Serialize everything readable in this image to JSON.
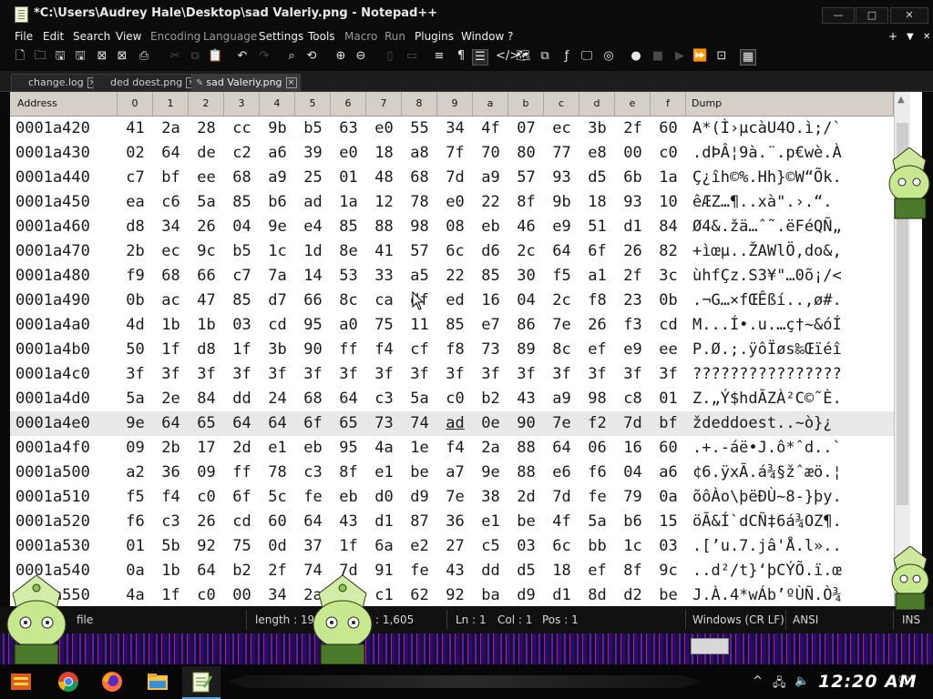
{
  "window": {
    "title": "*C:\\Users\\Audrey Hale\\Desktop\\sad Valeriy.png - Notepad++",
    "btn_min": "—",
    "btn_max": "□",
    "btn_close": "✕"
  },
  "menu": {
    "items": [
      "File",
      "Edit",
      "Search",
      "View",
      "Encoding",
      "Language",
      "Settings",
      "Tools",
      "Macro",
      "Run",
      "Plugins",
      "Window",
      "?"
    ],
    "right_plus": "+",
    "right_arrow": "▼",
    "right_close": "✕"
  },
  "tabs": [
    {
      "label": "change.log"
    },
    {
      "label": "ded doest.png"
    },
    {
      "label": "sad Valeriy.png"
    }
  ],
  "hex_header": {
    "address": "Address",
    "columns": [
      "0",
      "1",
      "2",
      "3",
      "4",
      "5",
      "6",
      "7",
      "8",
      "9",
      "a",
      "b",
      "c",
      "d",
      "e",
      "f"
    ],
    "dump": "Dump"
  },
  "hex_rows": [
    {
      "addr": "0001a420",
      "bytes": [
        "41",
        "2a",
        "28",
        "cc",
        "9b",
        "b5",
        "63",
        "e0",
        "55",
        "34",
        "4f",
        "07",
        "ec",
        "3b",
        "2f",
        "60"
      ],
      "dump": "A*(Ì›µcàU4O.ì;/`"
    },
    {
      "addr": "0001a430",
      "bytes": [
        "02",
        "64",
        "de",
        "c2",
        "a6",
        "39",
        "e0",
        "18",
        "a8",
        "7f",
        "70",
        "80",
        "77",
        "e8",
        "00",
        "c0"
      ],
      "dump": ".dÞÂ¦9à.¨.p€wè.À"
    },
    {
      "addr": "0001a440",
      "bytes": [
        "c7",
        "bf",
        "ee",
        "68",
        "a9",
        "25",
        "01",
        "48",
        "68",
        "7d",
        "a9",
        "57",
        "93",
        "d5",
        "6b",
        "1a"
      ],
      "dump": "Ç¿îh©%.Hh}©W“Õk."
    },
    {
      "addr": "0001a450",
      "bytes": [
        "ea",
        "c6",
        "5a",
        "85",
        "b6",
        "ad",
        "1a",
        "12",
        "78",
        "e0",
        "22",
        "8f",
        "9b",
        "18",
        "93",
        "10"
      ],
      "dump": "êÆZ…¶­..xà\".›.“."
    },
    {
      "addr": "0001a460",
      "bytes": [
        "d8",
        "34",
        "26",
        "04",
        "9e",
        "e4",
        "85",
        "88",
        "98",
        "08",
        "eb",
        "46",
        "e9",
        "51",
        "d1",
        "84"
      ],
      "dump": "Ø4&.žä…ˆ˜.ëFéQÑ„"
    },
    {
      "addr": "0001a470",
      "bytes": [
        "2b",
        "ec",
        "9c",
        "b5",
        "1c",
        "1d",
        "8e",
        "41",
        "57",
        "6c",
        "d6",
        "2c",
        "64",
        "6f",
        "26",
        "82"
      ],
      "dump": "+ìœµ..ŽAWlÖ,do&‚"
    },
    {
      "addr": "0001a480",
      "bytes": [
        "f9",
        "68",
        "66",
        "c7",
        "7a",
        "14",
        "53",
        "33",
        "a5",
        "22",
        "85",
        "30",
        "f5",
        "a1",
        "2f",
        "3c"
      ],
      "dump": "ùhfÇz.S3¥\"…0õ¡/<"
    },
    {
      "addr": "0001a490",
      "bytes": [
        "0b",
        "ac",
        "47",
        "85",
        "d7",
        "66",
        "8c",
        "ca",
        "df",
        "ed",
        "16",
        "04",
        "2c",
        "f8",
        "23",
        "0b"
      ],
      "dump": ".¬G…×fŒÊßí..,ø#."
    },
    {
      "addr": "0001a4a0",
      "bytes": [
        "4d",
        "1b",
        "1b",
        "03",
        "cd",
        "95",
        "a0",
        "75",
        "11",
        "85",
        "e7",
        "86",
        "7e",
        "26",
        "f3",
        "cd"
      ],
      "dump": "M...Í•.u.…ç†~&óÍ"
    },
    {
      "addr": "0001a4b0",
      "bytes": [
        "50",
        "1f",
        "d8",
        "1f",
        "3b",
        "90",
        "ff",
        "f4",
        "cf",
        "f8",
        "73",
        "89",
        "8c",
        "ef",
        "e9",
        "ee"
      ],
      "dump": "P.Ø.;.ÿôÏøs‰Œïéî"
    },
    {
      "addr": "0001a4c0",
      "bytes": [
        "3f",
        "3f",
        "3f",
        "3f",
        "3f",
        "3f",
        "3f",
        "3f",
        "3f",
        "3f",
        "3f",
        "3f",
        "3f",
        "3f",
        "3f",
        "3f"
      ],
      "dump": "????????????????"
    },
    {
      "addr": "0001a4d0",
      "bytes": [
        "5a",
        "2e",
        "84",
        "dd",
        "24",
        "68",
        "64",
        "c3",
        "5a",
        "c0",
        "b2",
        "43",
        "a9",
        "98",
        "c8",
        "01"
      ],
      "dump": "Z.„Ý$hdÃZÀ²C©˜È."
    },
    {
      "addr": "0001a4e0",
      "bytes": [
        "9e",
        "64",
        "65",
        "64",
        "64",
        "6f",
        "65",
        "73",
        "74",
        "ad",
        "0e",
        "90",
        "7e",
        "f2",
        "7d",
        "bf"
      ],
      "dump": "ždeddoest­..~ò}¿"
    },
    {
      "addr": "0001a4f0",
      "bytes": [
        "09",
        "2b",
        "17",
        "2d",
        "e1",
        "eb",
        "95",
        "4a",
        "1e",
        "f4",
        "2a",
        "88",
        "64",
        "06",
        "16",
        "60"
      ],
      "dump": ".+.-áë•J.ô*ˆd..`"
    },
    {
      "addr": "0001a500",
      "bytes": [
        "a2",
        "36",
        "09",
        "ff",
        "78",
        "c3",
        "8f",
        "e1",
        "be",
        "a7",
        "9e",
        "88",
        "e6",
        "f6",
        "04",
        "a6"
      ],
      "dump": "¢6.ÿxÃ.á¾§žˆæö.¦"
    },
    {
      "addr": "0001a510",
      "bytes": [
        "f5",
        "f4",
        "c0",
        "6f",
        "5c",
        "fe",
        "eb",
        "d0",
        "d9",
        "7e",
        "38",
        "2d",
        "7d",
        "fe",
        "79",
        "0a"
      ],
      "dump": "õôÀo\\þëÐÙ~8-}þy."
    },
    {
      "addr": "0001a520",
      "bytes": [
        "f6",
        "c3",
        "26",
        "cd",
        "60",
        "64",
        "43",
        "d1",
        "87",
        "36",
        "e1",
        "be",
        "4f",
        "5a",
        "b6",
        "15"
      ],
      "dump": "öÃ&Í`dCÑ‡6á¾OZ¶."
    },
    {
      "addr": "0001a530",
      "bytes": [
        "01",
        "5b",
        "92",
        "75",
        "0d",
        "37",
        "1f",
        "6a",
        "e2",
        "27",
        "c5",
        "03",
        "6c",
        "bb",
        "1c",
        "03"
      ],
      "dump": ".[’u.7.jâ'Å.l».."
    },
    {
      "addr": "0001a540",
      "bytes": [
        "0a",
        "1b",
        "64",
        "b2",
        "2f",
        "74",
        "7d",
        "91",
        "fe",
        "43",
        "dd",
        "d5",
        "18",
        "ef",
        "8f",
        "9c"
      ],
      "dump": "..d²/t}‘þCÝÕ.ï.œ"
    },
    {
      "addr": "0001a550",
      "bytes": [
        "4a",
        "1f",
        "c0",
        "00",
        "34",
        "2a",
        "",
        "c1",
        "62",
        "92",
        "ba",
        "d9",
        "d1",
        "8d",
        "d2",
        "be"
      ],
      "dump": "J.À.4*wÁb’ºÙÑ.Ò¾"
    }
  ],
  "status": {
    "file_type": "file",
    "length": "length : 19",
    "lines": ": 1,605",
    "ln": "Ln : 1",
    "col": "Col : 1",
    "pos": "Pos : 1",
    "eol": "Windows (CR LF)",
    "encoding": "ANSI",
    "ins": "INS"
  },
  "taskbar": {
    "clock": "12:20 AM"
  }
}
